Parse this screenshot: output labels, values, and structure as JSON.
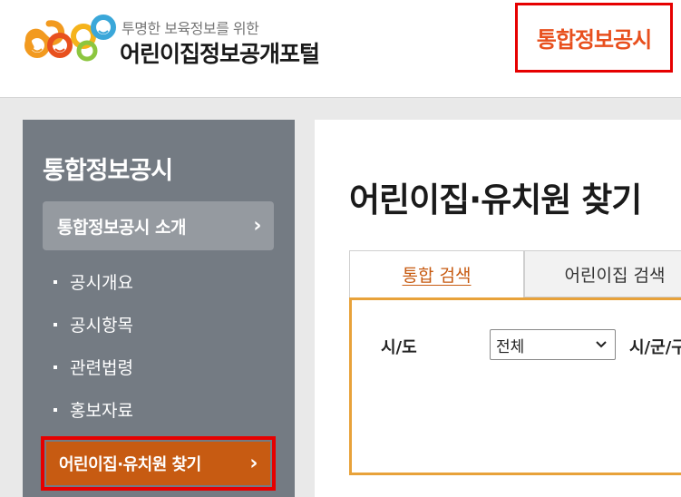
{
  "header": {
    "logo_sub": "투명한 보육정보를 위한",
    "logo_title": "어린이집정보공개포털",
    "top_link": "통합정보공시"
  },
  "sidebar": {
    "title": "통합정보공시",
    "active_item": "통합정보공시 소개",
    "chevron": "›",
    "items": [
      "공시개요",
      "공시항목",
      "관련법령",
      "홍보자료"
    ],
    "find_item": "어린이집·유치원 찾기"
  },
  "main": {
    "page_title": "어린이집·유치원 찾기",
    "tabs": [
      "통합 검색",
      "어린이집 검색"
    ],
    "search": {
      "sido_label": "시/도",
      "sido_value": "전체",
      "sigungu_label": "시/군/구"
    }
  },
  "colors": {
    "accent": "#c75b12",
    "highlight": "#e60000",
    "search_border": "#e8a23a",
    "sidebar_bg": "#747b83"
  },
  "icons": [
    "logo-icon",
    "chevron-right-icon",
    "bullet-icon",
    "dropdown-arrow-icon"
  ]
}
